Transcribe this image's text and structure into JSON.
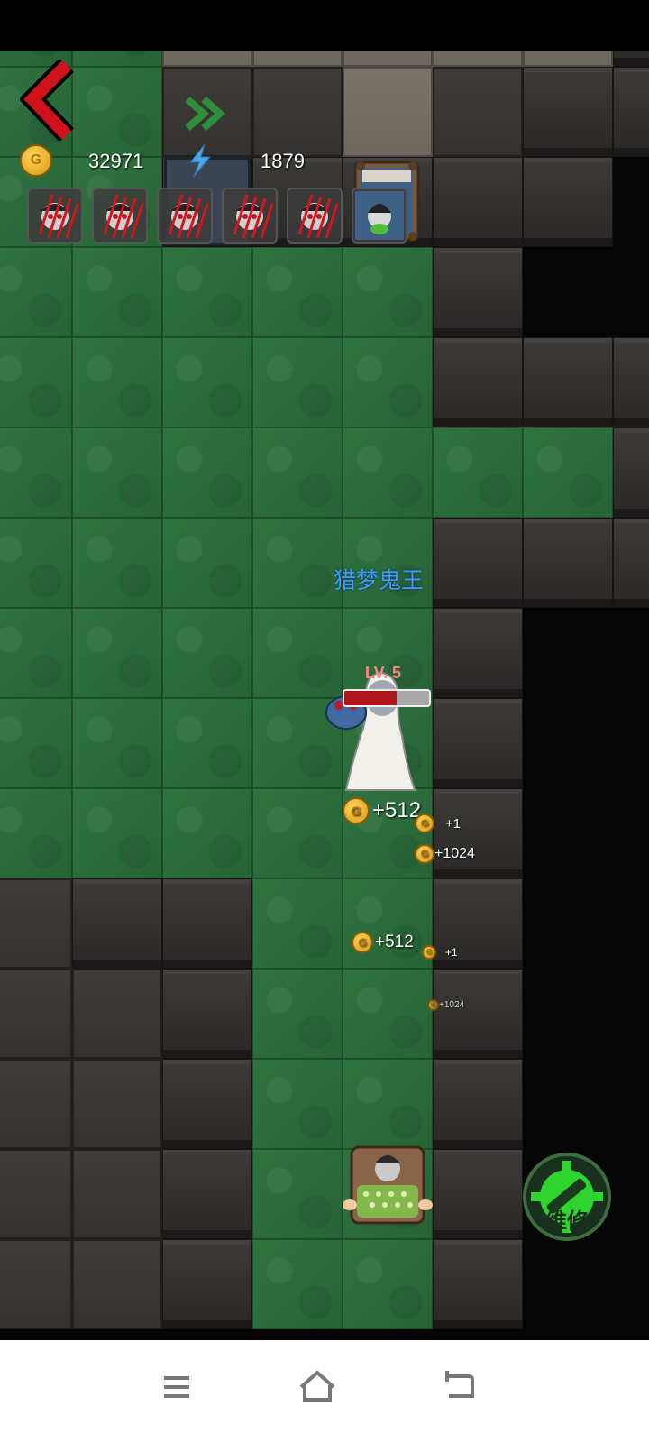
{
  "hud": {
    "gold_value": "32971",
    "energy_value": "1879",
    "coin_letter": "G"
  },
  "inventory": [
    {
      "name": "slot-1",
      "status": "clawed"
    },
    {
      "name": "slot-2",
      "status": "clawed"
    },
    {
      "name": "slot-3",
      "status": "clawed"
    },
    {
      "name": "slot-4",
      "status": "clawed"
    },
    {
      "name": "slot-5",
      "status": "clawed"
    },
    {
      "name": "slot-6",
      "status": "sleeping"
    }
  ],
  "boss": {
    "name": "猎梦鬼王",
    "level_text": "LV. 5",
    "hp_fraction": 0.62
  },
  "gains": [
    {
      "text": "+512"
    },
    {
      "text": "+1"
    },
    {
      "text": "+1024"
    },
    {
      "text": "+512"
    },
    {
      "text": "+1"
    },
    {
      "text": "+1024"
    }
  ],
  "repair_button": {
    "label": "维修"
  },
  "colors": {
    "grass": "#2b6b3a",
    "wall": "#3d3b38",
    "boss_name": "#3c9cff",
    "level_text": "#ff8484",
    "hp_fill": "#b0151c",
    "back_arrow": "#d0121b",
    "repair_icon": "#2fd52f"
  },
  "icons": {
    "back": "chevron-left-icon",
    "gold": "gold-coin-icon",
    "energy": "lightning-icon",
    "repair": "wrench-gear-icon",
    "nav_menu": "menu-icon",
    "nav_home": "home-icon",
    "nav_back": "back-icon"
  }
}
